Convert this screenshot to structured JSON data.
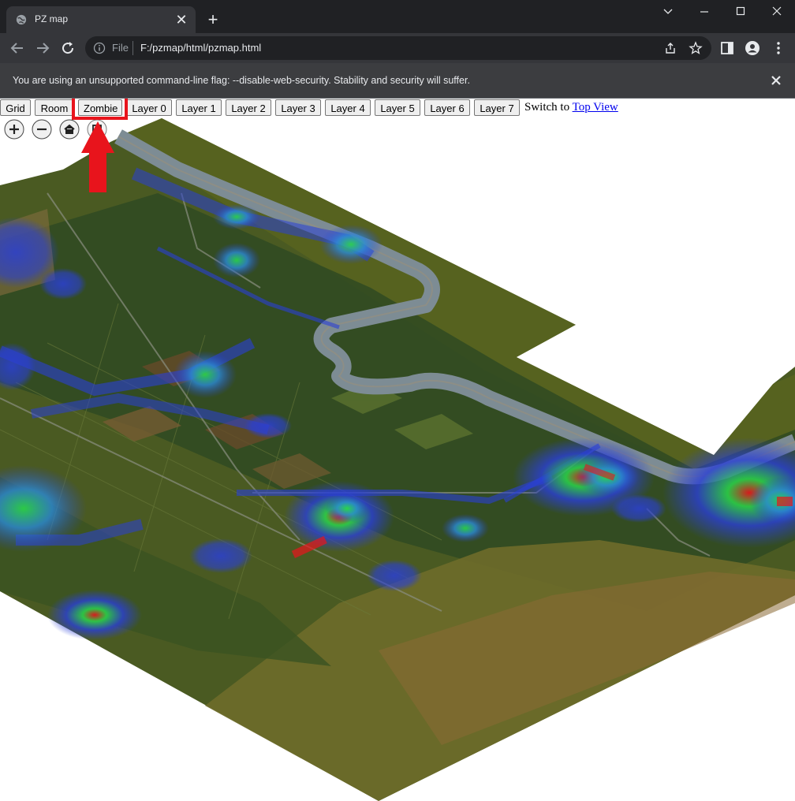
{
  "browser": {
    "tab_title": "PZ map",
    "omnibox_scheme": "File",
    "omnibox_url": "F:/pzmap/html/pzmap.html",
    "infobar_message": "You are using an unsupported command-line flag: --disable-web-security. Stability and security will suffer."
  },
  "page": {
    "buttons": [
      "Grid",
      "Room",
      "Zombie",
      "Layer 0",
      "Layer 1",
      "Layer 2",
      "Layer 3",
      "Layer 4",
      "Layer 5",
      "Layer 6",
      "Layer 7"
    ],
    "switch_prefix": "Switch to",
    "switch_link": "Top View",
    "highlighted_button": "Zombie"
  },
  "colors": {
    "highlight": "#e8141c",
    "heatmap_low": "#2a3fd6",
    "heatmap_mid": "#2ad64a",
    "heatmap_high": "#e8141c",
    "river": "#7d8c94",
    "terrain": "#4a5a22"
  },
  "icons": [
    "globe-icon",
    "close-icon",
    "plus-icon",
    "back-icon",
    "forward-icon",
    "reload-icon",
    "info-icon",
    "share-icon",
    "star-icon",
    "sidepanel-icon",
    "profile-icon",
    "menu-icon",
    "zoom-in-icon",
    "zoom-out-icon",
    "home-icon",
    "fullscreen-icon"
  ]
}
